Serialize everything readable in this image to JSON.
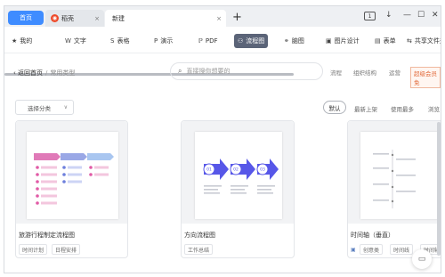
{
  "tabs": {
    "home": "首页",
    "daoke": "稻壳",
    "new": "新建",
    "close": "×",
    "plus": "+"
  },
  "window": {
    "badge": "1",
    "minimize": "—",
    "maximize": "☐",
    "close": "✕",
    "extra": "↓"
  },
  "ribbon": {
    "items": [
      {
        "label": "我的",
        "icon": "★"
      },
      {
        "label": "文字",
        "icon": "W"
      },
      {
        "label": "表格",
        "icon": "S"
      },
      {
        "label": "演示",
        "icon": "P"
      },
      {
        "label": "PDF",
        "icon": "ℙ"
      },
      {
        "label": "流程图",
        "icon": "⚇"
      },
      {
        "label": "脑图",
        "icon": "⚭"
      },
      {
        "label": "图片设计",
        "icon": "▣"
      },
      {
        "label": "表单",
        "icon": "▤"
      },
      {
        "label": "共享文件夹",
        "icon": "⇆"
      }
    ]
  },
  "breadcrumb": {
    "back": "返回首页",
    "sep": "/",
    "current": "常用类型"
  },
  "search": {
    "placeholder": "直接搜你想要的"
  },
  "tags": [
    "流程",
    "组织结构",
    "运营",
    "超级会员免"
  ],
  "filter": {
    "label": "选择分类",
    "chevron": "∨"
  },
  "sort": {
    "default": "默认",
    "options": [
      "最新上架",
      "使用最多",
      "浏览"
    ]
  },
  "cards": [
    {
      "title": "旅游行程制定流程图",
      "chips": [
        "时间计划",
        "日程安排"
      ]
    },
    {
      "title": "方向流程图",
      "chips": [
        "工作总结"
      ]
    },
    {
      "title": "时间轴（垂直）",
      "chips": [
        "创意类",
        "时间线",
        "时间轴"
      ]
    }
  ],
  "arrows": {
    "steps": [
      "01",
      "02",
      "03"
    ]
  },
  "colors": {
    "accent": "#3f8cff",
    "active_tab": "#5b6478",
    "promo": "#e26b3c",
    "arrow_blue": "#5757e8"
  }
}
